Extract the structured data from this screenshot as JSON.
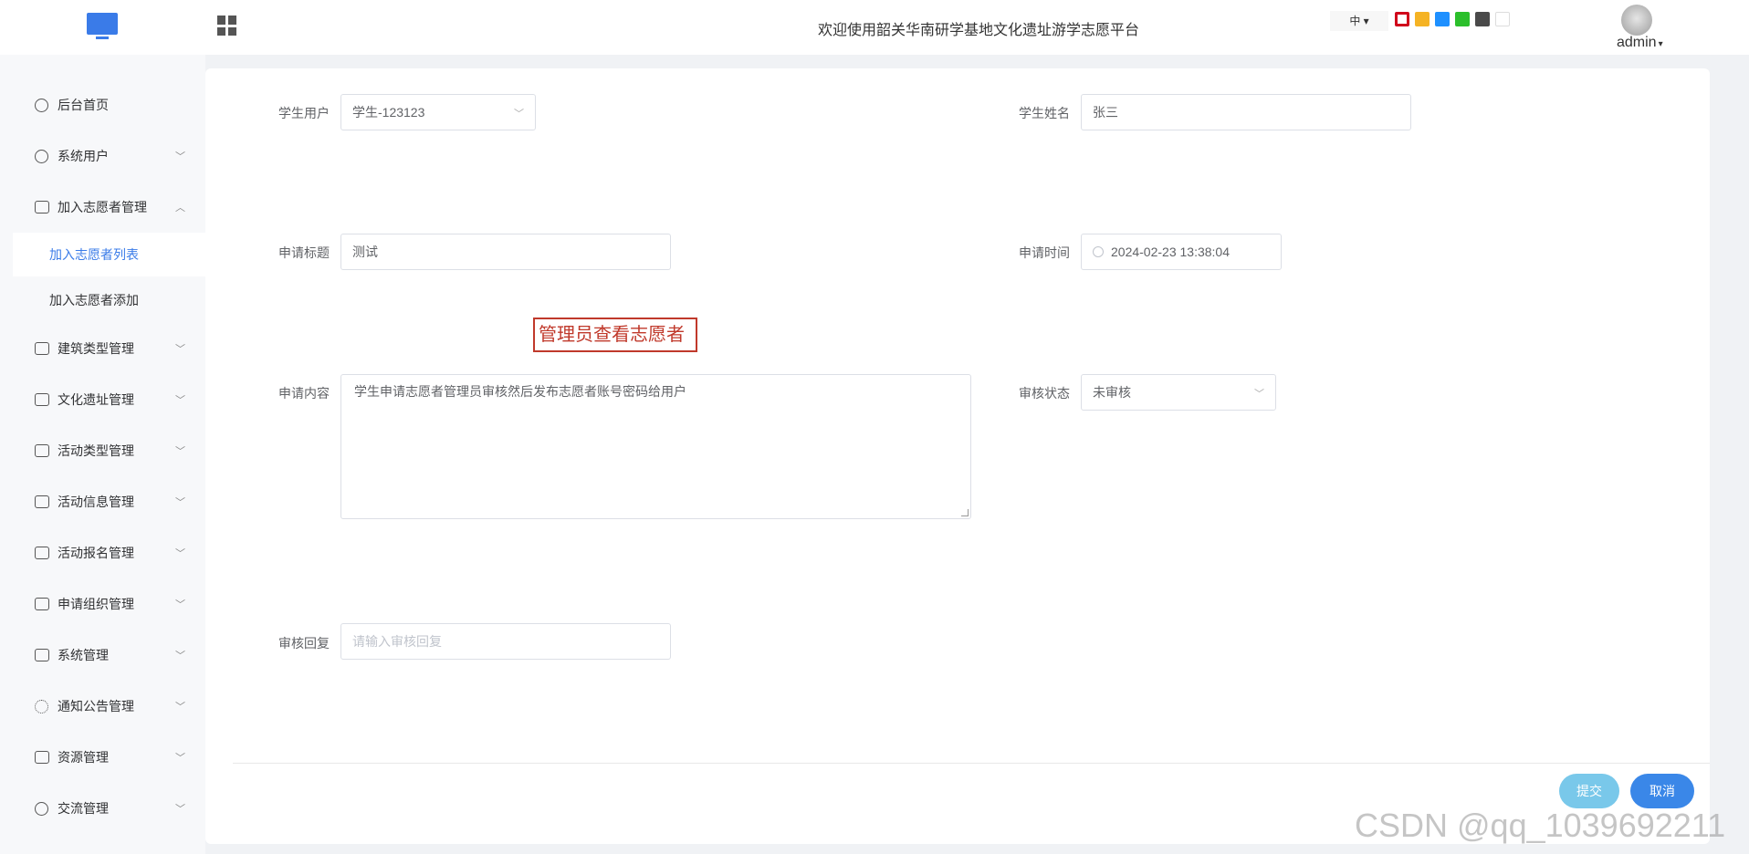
{
  "header": {
    "title": "欢迎使用韶关华南研学基地文化遗址游学志愿平台",
    "lang": "中",
    "theme_colors": [
      "#d0021b",
      "#f5b324",
      "#1e90ff",
      "#2bbf2b",
      "#4a4a4a",
      "#ffffff"
    ],
    "user": "admin"
  },
  "sidebar": {
    "items": [
      {
        "label": "后台首页",
        "icon": "dashboard-icon",
        "arrow": ""
      },
      {
        "label": "系统用户",
        "icon": "user-icon",
        "arrow": "﹀"
      },
      {
        "label": "加入志愿者管理",
        "icon": "list-icon",
        "arrow": "︿"
      },
      {
        "label": "建筑类型管理",
        "icon": "list-icon",
        "arrow": "﹀"
      },
      {
        "label": "文化遗址管理",
        "icon": "list-icon",
        "arrow": "﹀"
      },
      {
        "label": "活动类型管理",
        "icon": "list-icon",
        "arrow": "﹀"
      },
      {
        "label": "活动信息管理",
        "icon": "list-icon",
        "arrow": "﹀"
      },
      {
        "label": "活动报名管理",
        "icon": "list-icon",
        "arrow": "﹀"
      },
      {
        "label": "申请组织管理",
        "icon": "list-icon",
        "arrow": "﹀"
      },
      {
        "label": "系统管理",
        "icon": "folder-icon",
        "arrow": "﹀"
      },
      {
        "label": "通知公告管理",
        "icon": "loading-icon",
        "arrow": "﹀"
      },
      {
        "label": "资源管理",
        "icon": "printer-icon",
        "arrow": "﹀"
      },
      {
        "label": "交流管理",
        "icon": "headset-icon",
        "arrow": "﹀"
      }
    ],
    "sub_items": [
      {
        "label": "加入志愿者列表",
        "active": true
      },
      {
        "label": "加入志愿者添加",
        "active": false
      }
    ]
  },
  "form": {
    "student_user_label": "学生用户",
    "student_user_value": "学生-123123",
    "student_name_label": "学生姓名",
    "student_name_value": "张三",
    "apply_title_label": "申请标题",
    "apply_title_value": "测试",
    "apply_time_label": "申请时间",
    "apply_time_value": "2024-02-23 13:38:04",
    "apply_content_label": "申请内容",
    "apply_content_value": "学生申请志愿者管理员审核然后发布志愿者账号密码给用户",
    "review_status_label": "审核状态",
    "review_status_value": "未审核",
    "review_reply_label": "审核回复",
    "review_reply_placeholder": "请输入审核回复",
    "submit_label": "提交",
    "cancel_label": "取消"
  },
  "annotation": "管理员查看志愿者",
  "watermark": "CSDN @qq_1039692211"
}
